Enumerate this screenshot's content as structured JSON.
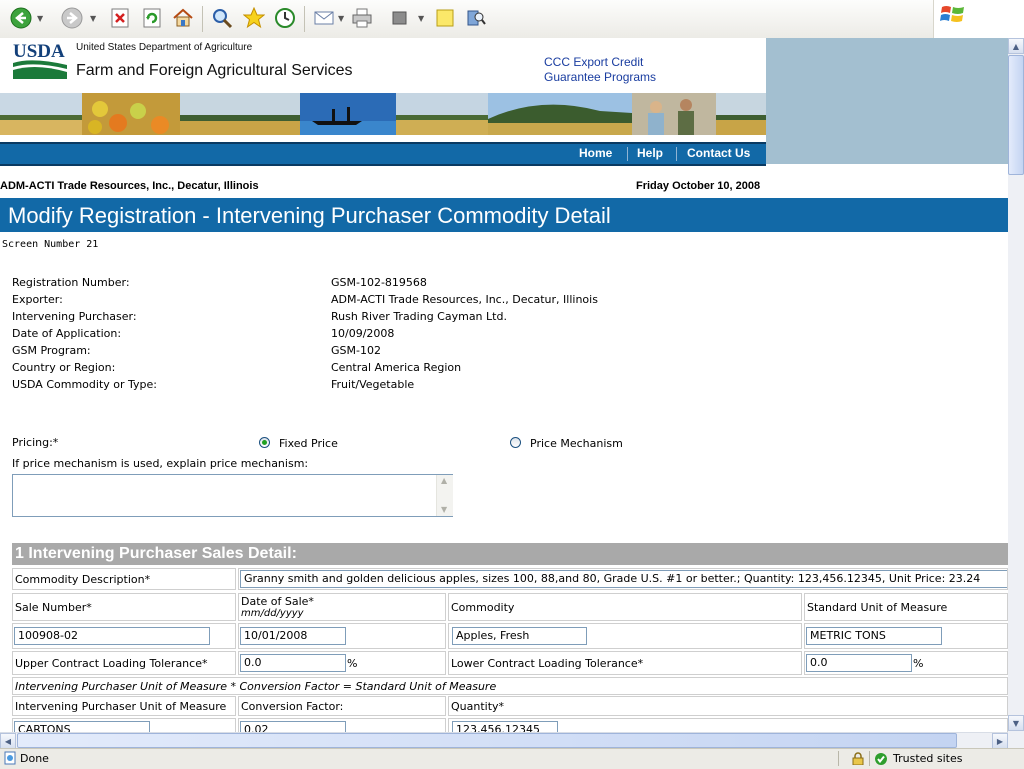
{
  "browser": {
    "status_text": "Done",
    "zone_text": "Trusted sites"
  },
  "header": {
    "logo_text": "USDA",
    "dept": "United States Department of Agriculture",
    "agency": "Farm and Foreign Agricultural Services",
    "ccc_link_line1": "CCC Export Credit",
    "ccc_link_line2": "Guarantee Programs"
  },
  "nav": {
    "home": "Home",
    "help": "Help",
    "contact": "Contact Us"
  },
  "org_line": "ADM-ACTI Trade Resources, Inc., Decatur, Illinois",
  "date_line": "Friday October 10, 2008",
  "title": "Modify Registration - Intervening Purchaser Commodity Detail",
  "screen_number": "Screen Number 21",
  "registration": [
    {
      "label": "Registration Number:",
      "value": "GSM-102-819568"
    },
    {
      "label": "Exporter:",
      "value": "ADM-ACTI Trade Resources, Inc., Decatur, Illinois"
    },
    {
      "label": "Intervening Purchaser:",
      "value": "Rush River Trading Cayman Ltd."
    },
    {
      "label": "Date of Application:",
      "value": "10/09/2008"
    },
    {
      "label": "GSM Program:",
      "value": "GSM-102"
    },
    {
      "label": "Country or Region:",
      "value": "Central America Region"
    },
    {
      "label": "USDA Commodity or Type:",
      "value": "Fruit/Vegetable"
    }
  ],
  "pricing": {
    "label": "Pricing:*",
    "option_fixed": "Fixed Price",
    "option_mechanism": "Price Mechanism",
    "selected": "Fixed Price",
    "mechanism_prompt": "If price mechanism is used, explain price mechanism:",
    "mechanism_text": ""
  },
  "sales": {
    "title": "1 Intervening Purchaser Sales Detail:",
    "commodity_description_label": "Commodity Description*",
    "commodity_description": "Granny smith and golden delicious apples, sizes 100, 88,and 80, Grade U.S. #1 or better.; Quantity: 123,456.12345, Unit Price: 23.24",
    "sale_number_label": "Sale Number*",
    "date_of_sale_label": "Date of Sale*",
    "date_format": "mm/dd/yyyy",
    "commodity_label": "Commodity",
    "unit_label": "Standard Unit of Measure",
    "sale_number": "100908-02",
    "date_of_sale": "10/01/2008",
    "commodity": "Apples, Fresh",
    "unit": "METRIC TONS",
    "upper_label": "Upper Contract Loading Tolerance*",
    "upper_value": "0.0",
    "lower_label": "Lower Contract Loading Tolerance*",
    "lower_value": "0.0",
    "pct": "%",
    "formula": "Intervening Purchaser Unit of Measure * Conversion Factor = Standard Unit of Measure",
    "ip_unit_label": "Intervening Purchaser Unit of Measure",
    "conversion_label": "Conversion Factor:",
    "quantity_label": "Quantity*",
    "ip_unit": "CARTONS",
    "conversion": "0.02",
    "quantity": "123,456.12345"
  }
}
